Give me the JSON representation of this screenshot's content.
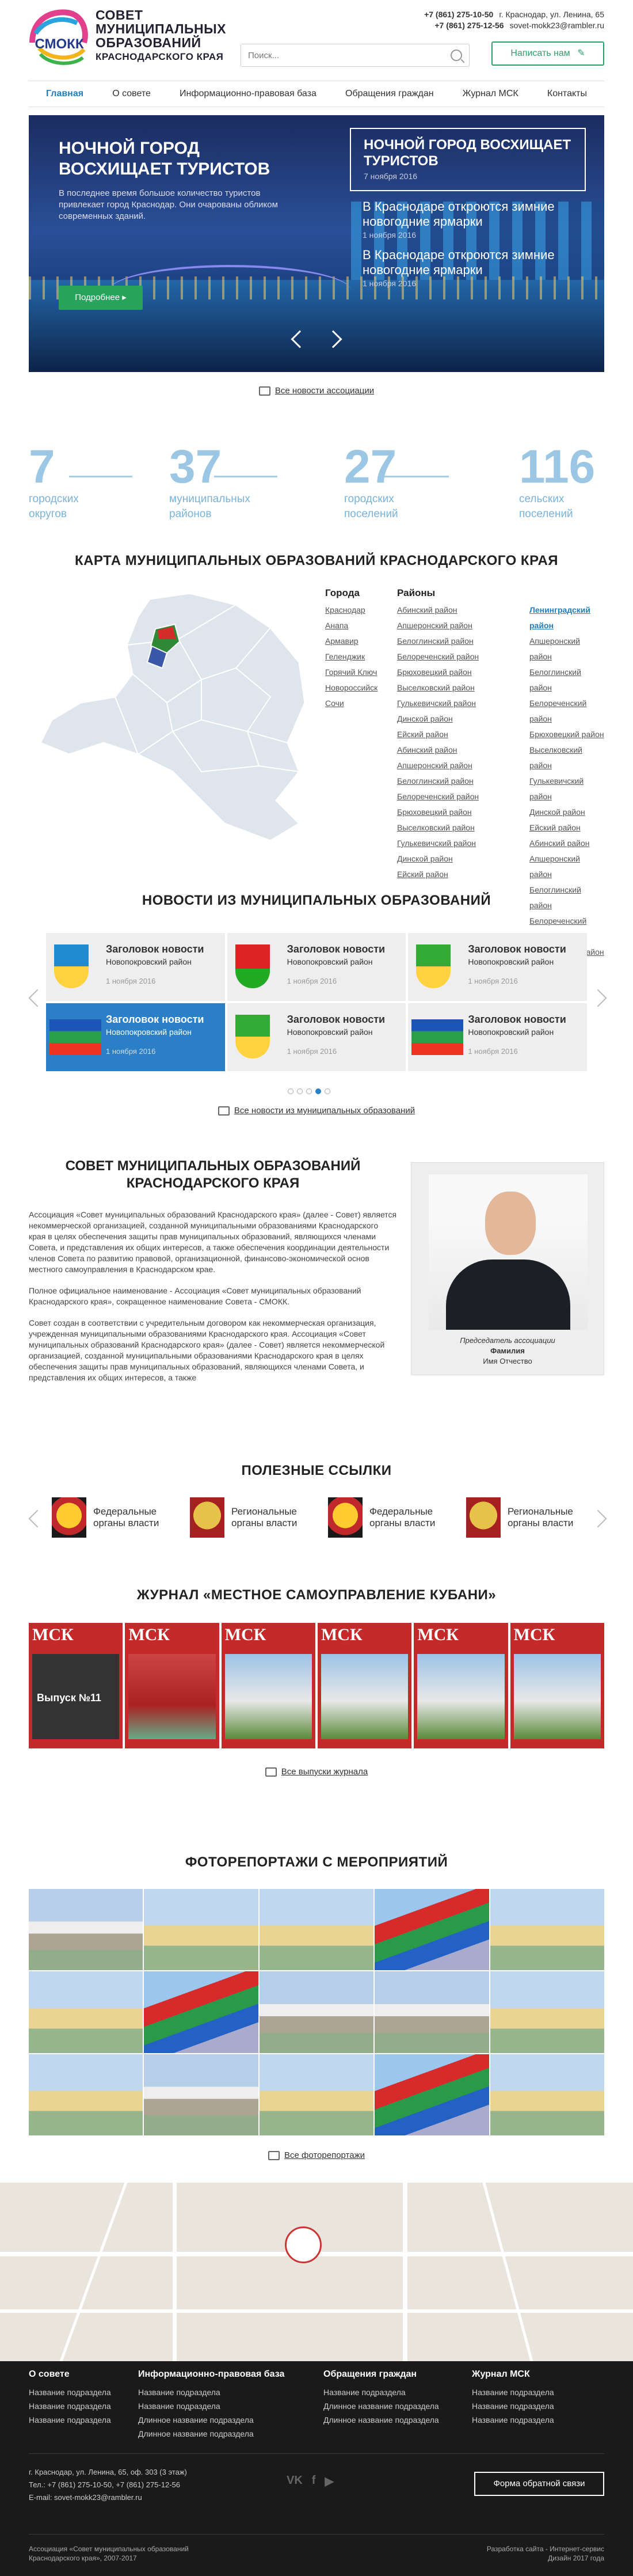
{
  "header": {
    "logo_text": "СМОКК",
    "brand_line1": "Совет",
    "brand_line2": "муниципальных",
    "brand_line3": "образований",
    "brand_sub": "Краснодарского края",
    "search_placeholder": "Поиск...",
    "phone1": "+7 (861) 275-10-50",
    "phone2": "+7 (861) 275-12-56",
    "address": "г. Краснодар, ул. Ленина, 65",
    "email": "sovet-mokk23@rambler.ru",
    "write_button": "Написать нам"
  },
  "nav": [
    "Главная",
    "О совете",
    "Информационно-правовая база",
    "Обращения граждан",
    "Журнал МСК",
    "Контакты"
  ],
  "hero": {
    "title": "Ночной город восхищает туристов",
    "text": "В последнее время большое количество туристов привлекает город Краснодар. Они очарованы обликом современных зданий.",
    "more_button": "Подробнее",
    "side_items": [
      {
        "title": "Ночной город восхищает туристов",
        "date": "7 ноября 2016"
      },
      {
        "title": "В Краснодаре откроются зимние новогодние ярмарки",
        "date": "1 ноября 2016"
      },
      {
        "title": "В Краснодаре откроются зимние новогодние ярмарки",
        "date": "1 ноября 2016"
      }
    ],
    "all_news_link": "Все новости ассоциации"
  },
  "stats": [
    {
      "number": "7",
      "label1": "городских",
      "label2": "округов"
    },
    {
      "number": "37",
      "label1": "муниципальных",
      "label2": "районов"
    },
    {
      "number": "27",
      "label1": "городских",
      "label2": "поселений"
    },
    {
      "number": "116",
      "label1": "сельских",
      "label2": "поселений"
    }
  ],
  "map": {
    "title": "Карта муниципальных образований Краснодарского края",
    "cities_head": "Города",
    "districts_head": "Районы",
    "cities": [
      "Краснодар",
      "Анапа",
      "Армавир",
      "Геленджик",
      "Горячий Ключ",
      "Новороссийск",
      "Сочи"
    ],
    "districts_col1": [
      "Абинский район",
      "Апшеронский район",
      "Белоглинский район",
      "Белореченский район",
      "Брюховецкий район",
      "Выселковский район",
      "Гулькевичский район",
      "Динской район",
      "Ейский район",
      "Абинский район",
      "Апшеронский район",
      "Белоглинский район",
      "Белореченский район",
      "Брюховецкий район",
      "Выселковский район",
      "Гулькевичский район",
      "Динской район",
      "Ейский район"
    ],
    "districts_col2": [
      "Ленинградский район",
      "Апшеронский район",
      "Белоглинский район",
      "Белореченский район",
      "Брюховецкий район",
      "Выселковский район",
      "Гулькевичский район",
      "Динской район",
      "Ейский район",
      "Абинский район",
      "Апшеронский район",
      "Белоглинский район",
      "Белореченский район",
      "Брюховецкий район"
    ]
  },
  "news": {
    "title": "Новости из муниципальных образований",
    "items": [
      {
        "title": "Заголовок новости",
        "sub": "Новопокровский район",
        "date": "1 ноября 2016"
      },
      {
        "title": "Заголовок новости",
        "sub": "Новопокровский район",
        "date": "1 ноября 2016"
      },
      {
        "title": "Заголовок новости",
        "sub": "Новопокровский район",
        "date": "1 ноября 2016"
      },
      {
        "title": "Заголовок новости",
        "sub": "Новопокровский район",
        "date": "1 ноября 2016"
      },
      {
        "title": "Заголовок новости",
        "sub": "Новопокровский район",
        "date": "1 ноября 2016"
      },
      {
        "title": "Заголовок новости",
        "sub": "Новопокровский район",
        "date": "1 ноября 2016"
      }
    ],
    "all_link": "Все новости из муниципальных образований"
  },
  "about": {
    "title": "Совет муниципальных образований Краснодарского края",
    "p1": "Ассоциация «Совет муниципальных образований Краснодарского края» (далее - Совет) является некоммерческой организацией, созданной муниципальными образованиями Краснодарского края в целях обеспечения защиты прав муниципальных образований, являющихся членами Совета, и представления их общих интересов, а также обеспечения координации деятельности членов Совета по развитию правовой, организационной, финансово-экономической основ местного самоуправления в Краснодарском крае.",
    "p2": "Полное официальное наименование - Ассоциация «Совет муниципальных образований Краснодарского края», сокращенное наименование Совета - СМОКК.",
    "p3": "Совет создан в соответствии с учредительным договором как некоммерческая организация, учрежденная муниципальными образованиями Краснодарского края. Ассоциация «Совет муниципальных образований Краснодарского края» (далее - Совет) является некоммерческой организацией, созданной муниципальными образованиями Краснодарского края в целях обеспечения защиты прав муниципальных образований, являющихся членами Совета, и представления их общих интересов, а также",
    "caption_role": "Председатель ассоциации",
    "caption_name": "Фамилия",
    "caption_patronymic": "Имя Отчество"
  },
  "useful": {
    "title": "Полезные ссылки",
    "items": [
      {
        "line1": "Федеральные",
        "line2": "органы власти"
      },
      {
        "line1": "Региональные",
        "line2": "органы власти"
      },
      {
        "line1": "Федеральные",
        "line2": "органы власти"
      },
      {
        "line1": "Региональные",
        "line2": "органы власти"
      }
    ]
  },
  "magazine": {
    "title": "Журнал «Местное самоуправление Кубани»",
    "cover_label": "МСК",
    "issue": "Выпуск №11",
    "all_link": "Все выпуски журнала"
  },
  "photo": {
    "title": "Фоторепортажи с мероприятий",
    "all_link": "Все фоторепортажи"
  },
  "footer": {
    "cols": [
      {
        "head": "О совете",
        "items": [
          "Название подраздела",
          "Название подраздела",
          "Название подраздела"
        ]
      },
      {
        "head": "Информационно-правовая база",
        "items": [
          "Название подраздела",
          "Название подраздела",
          "Длинное название подраздела",
          "Длинное название подраздела"
        ]
      },
      {
        "head": "Обращения граждан",
        "items": [
          "Название подраздела",
          "Длинное название подраздела",
          "Длинное название подраздела"
        ]
      },
      {
        "head": "Журнал МСК",
        "items": [
          "Название подраздела",
          "Название подраздела",
          "Название подраздела"
        ]
      }
    ],
    "address": "г. Краснодар, ул. Ленина, 65, оф. 303 (3 этаж)",
    "tel": "Тел.: +7 (861) 275-10-50, +7 (861) 275-12-56",
    "email": "E-mail: sovet-mokk23@rambler.ru",
    "feedback_button": "Форма обратной связи",
    "copy1": "Ассоциация «Совет муниципальных образований",
    "copy2": "Краснодарского края», 2007-2017",
    "dev1": "Разработка сайта - Интернет-сервис",
    "dev2": "Дизайн 2017 года"
  }
}
